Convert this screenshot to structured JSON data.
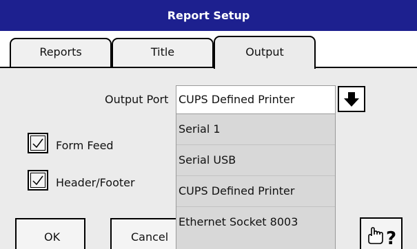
{
  "window": {
    "title": "Report Setup"
  },
  "tabs": [
    {
      "label": "Reports"
    },
    {
      "label": "Title"
    },
    {
      "label": "Output"
    }
  ],
  "output_port": {
    "label": "Output Port",
    "selected": "CUPS Defined Printer",
    "options": [
      "Serial 1",
      "Serial USB",
      "CUPS Defined Printer",
      "Ethernet Socket 8003"
    ]
  },
  "checkboxes": [
    {
      "label": "Form Feed",
      "checked": true
    },
    {
      "label": "Header/Footer",
      "checked": true
    }
  ],
  "buttons": {
    "ok": "OK",
    "cancel": "Cancel",
    "help_icon": "pointing-hand-help-icon"
  },
  "colors": {
    "titlebar": "#1d208f",
    "panel": "#ebebeb",
    "dropdown_list": "#d8d8d8"
  }
}
